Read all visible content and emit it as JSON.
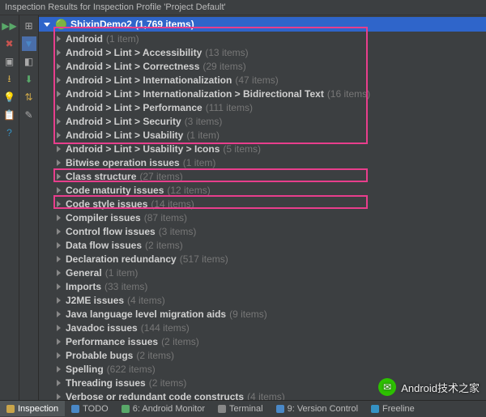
{
  "title": "Inspection Results for Inspection Profile 'Project Default'",
  "root": {
    "label": "ShixinDemo2",
    "count": "(1,769 items)"
  },
  "items": [
    {
      "label": "Android",
      "count": "(1 item)"
    },
    {
      "label": "Android > Lint > Accessibility",
      "count": "(13 items)"
    },
    {
      "label": "Android > Lint > Correctness",
      "count": "(29 items)"
    },
    {
      "label": "Android > Lint > Internationalization",
      "count": "(47 items)"
    },
    {
      "label": "Android > Lint > Internationalization > Bidirectional Text",
      "count": "(16 items)"
    },
    {
      "label": "Android > Lint > Performance",
      "count": "(111 items)"
    },
    {
      "label": "Android > Lint > Security",
      "count": "(3 items)"
    },
    {
      "label": "Android > Lint > Usability",
      "count": "(1 item)"
    },
    {
      "label": "Android > Lint > Usability > Icons",
      "count": "(5 items)"
    },
    {
      "label": "Bitwise operation issues",
      "count": "(1 item)"
    },
    {
      "label": "Class structure",
      "count": "(27 items)"
    },
    {
      "label": "Code maturity issues",
      "count": "(12 items)"
    },
    {
      "label": "Code style issues",
      "count": "(14 items)"
    },
    {
      "label": "Compiler issues",
      "count": "(87 items)"
    },
    {
      "label": "Control flow issues",
      "count": "(3 items)"
    },
    {
      "label": "Data flow issues",
      "count": "(2 items)"
    },
    {
      "label": "Declaration redundancy",
      "count": "(517 items)"
    },
    {
      "label": "General",
      "count": "(1 item)"
    },
    {
      "label": "Imports",
      "count": "(33 items)"
    },
    {
      "label": "J2ME issues",
      "count": "(4 items)"
    },
    {
      "label": "Java language level migration aids",
      "count": "(9 items)"
    },
    {
      "label": "Javadoc issues",
      "count": "(144 items)"
    },
    {
      "label": "Performance issues",
      "count": "(2 items)"
    },
    {
      "label": "Probable bugs",
      "count": "(2 items)"
    },
    {
      "label": "Spelling",
      "count": "(622 items)"
    },
    {
      "label": "Threading issues",
      "count": "(2 items)"
    },
    {
      "label": "Verbose or redundant code constructs",
      "count": "(4 items)"
    }
  ],
  "bottomTabs": {
    "inspection": "Inspection",
    "todo": "TODO",
    "androidMonitor": "6: Android Monitor",
    "terminal": "Terminal",
    "versionControl": "9: Version Control",
    "freeline": "Freeline"
  },
  "watermark": "Android技术之家"
}
